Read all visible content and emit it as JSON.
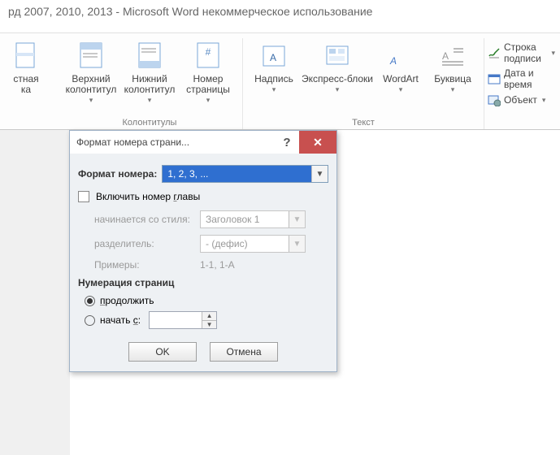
{
  "titlebar": "рд 2007, 2010, 2013  -  Microsoft Word некоммерческое использование",
  "ribbon": {
    "group_page_partial": {
      "btn_label": "стная\nка"
    },
    "group_hf": {
      "header": "Верхний\nколонтитул",
      "footer": "Нижний\nколонтитул",
      "pagenum": "Номер\nстраницы",
      "label": "Колонтитулы"
    },
    "group_text": {
      "textbox": "Надпись",
      "quick": "Экспресс-блоки",
      "wordart": "WordArt",
      "dropcap": "Буквица",
      "label": "Текст"
    },
    "side": {
      "sig": "Строка подписи",
      "date": "Дата и время",
      "object": "Объект"
    }
  },
  "dialog": {
    "title": "Формат номера страни...",
    "fmt_label": "Формат номера:",
    "fmt_value": "1, 2, 3, ...",
    "include_chapter": "Включить номер главы",
    "include_chapter_underline_char": "г",
    "starts_style_label": "начинается со стиля:",
    "starts_style_value": "Заголовок 1",
    "sep_label": "разделитель:",
    "sep_value": "-   (дефис)",
    "examples_label": "Примеры:",
    "examples_value": "1-1, 1-A",
    "numbering_head": "Нумерация страниц",
    "continue": "продолжить",
    "start_at": "начать с:",
    "start_at_underline_char": "с",
    "ok": "OK",
    "cancel": "Отмена"
  }
}
